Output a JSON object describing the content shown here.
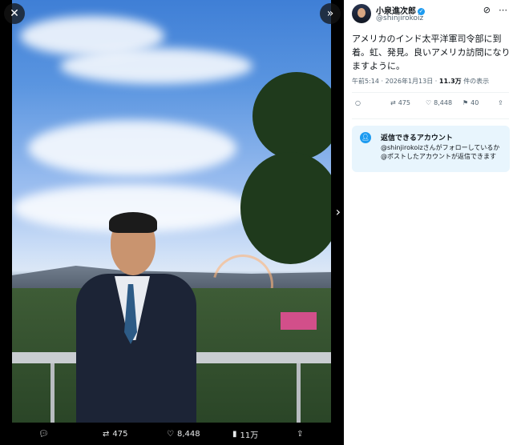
{
  "media": {
    "close_icon": "close-icon",
    "expand_icon": "chevrons-right-icon",
    "next_icon": "chevron-right-icon",
    "actions": {
      "reply_count": "",
      "retweet_count": "475",
      "like_count": "8,448",
      "views_count": "11万"
    }
  },
  "post": {
    "author_name": "小泉進次郎",
    "author_handle": "@shinjirokoiz",
    "text": "アメリカのインド太平洋軍司令部に到着。虹、発見。良いアメリカ訪問になりますように。",
    "time": "午前5:14",
    "date": "2026年1月13日",
    "views": "11.3万",
    "views_suffix": "件の表示",
    "separator": "·",
    "actions": {
      "retweet_count": "475",
      "like_count": "8,448",
      "bookmark_count": "40"
    }
  },
  "reply_notice": {
    "title": "返信できるアカウント",
    "body": "@shinjirokoizさんがフォローしているか@ポストしたアカウントが返信できます"
  },
  "colors": {
    "accent": "#1d9bf0",
    "notice_bg": "#e8f5fd"
  }
}
